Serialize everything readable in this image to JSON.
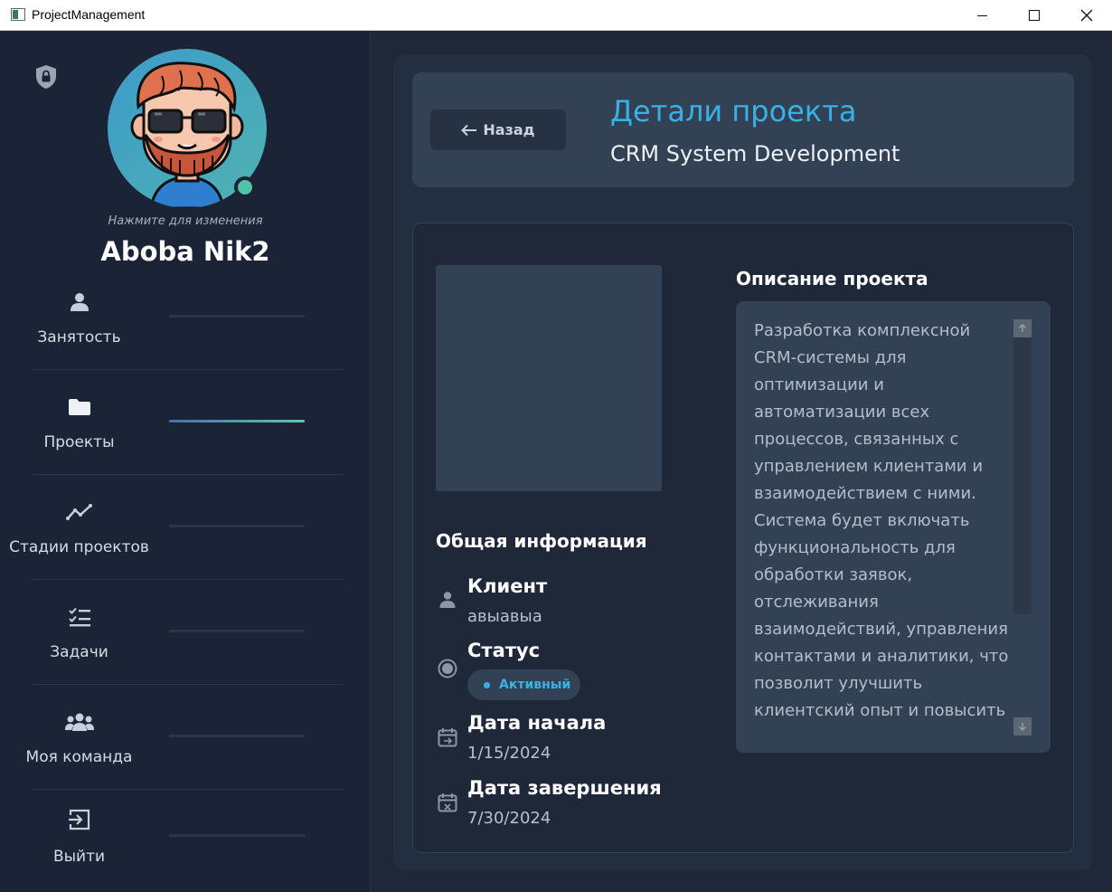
{
  "window": {
    "title": "ProjectManagement"
  },
  "sidebar": {
    "avatar_hint": "Нажмите для изменения",
    "user_name": "Aboba Nik2",
    "items": [
      {
        "label": "Занятость",
        "icon": "user-icon",
        "active": false
      },
      {
        "label": "Проекты",
        "icon": "folder-icon",
        "active": true
      },
      {
        "label": "Стадии проектов",
        "icon": "chart-line-icon",
        "active": false
      },
      {
        "label": "Задачи",
        "icon": "tasks-icon",
        "active": false
      },
      {
        "label": "Моя команда",
        "icon": "team-icon",
        "active": false
      },
      {
        "label": "Выйти",
        "icon": "logout-icon",
        "active": false
      }
    ]
  },
  "header": {
    "back_label": "Назад",
    "title": "Детали проекта",
    "subtitle": "CRM System Development"
  },
  "general": {
    "title": "Общая информация",
    "client_label": "Клиент",
    "client_value": "авыавыа",
    "status_label": "Статус",
    "status_value": "Активный",
    "start_label": "Дата начала",
    "start_value": "1/15/2024",
    "end_label": "Дата завершения",
    "end_value": "7/30/2024"
  },
  "description": {
    "title": "Описание проекта",
    "text": "Разработка комплексной CRM-системы для оптимизации и автоматизации всех процессов, связанных с управлением клиентами и взаимодействием с ними. Система будет включать функциональность для обработки заявок, отслеживания взаимодействий, управления контактами и аналитики, что позволит улучшить клиентский опыт и повысить производительность команды. Также будет"
  },
  "colors": {
    "accent": "#38b2e6",
    "online": "#4fc4a6",
    "card": "#334155"
  }
}
